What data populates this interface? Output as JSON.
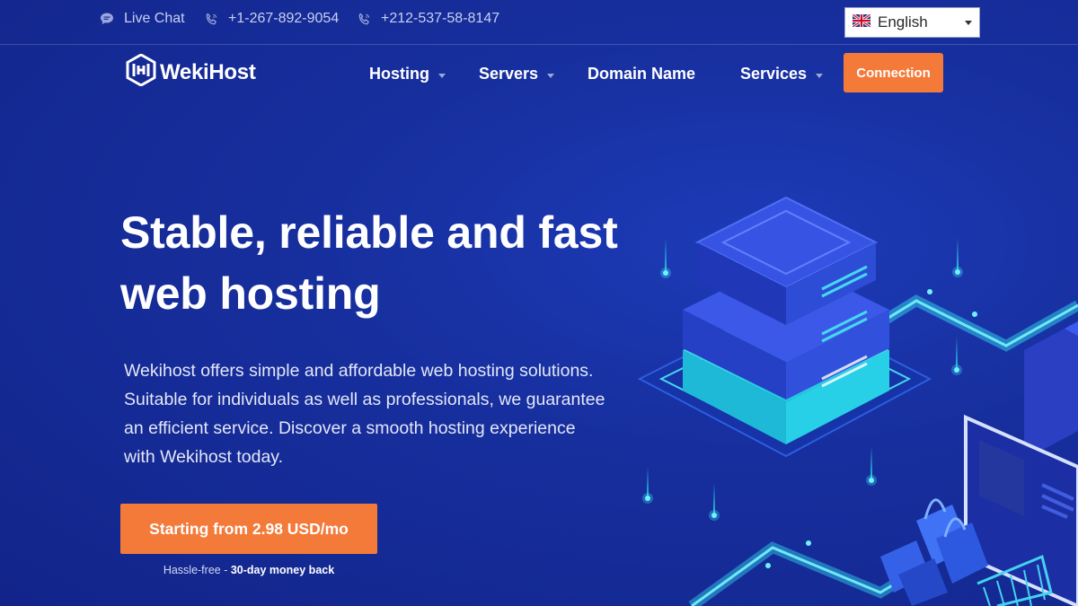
{
  "topbar": {
    "live_chat": "Live Chat",
    "phone_1": "+1-267-892-9054",
    "phone_2": "+212-537-58-8147",
    "language": "English"
  },
  "nav": {
    "logo_text": "WekiHost",
    "items": [
      {
        "label": "Hosting",
        "has_dropdown": true
      },
      {
        "label": "Servers",
        "has_dropdown": true
      },
      {
        "label": "Domain Name",
        "has_dropdown": false
      },
      {
        "label": "Services",
        "has_dropdown": true
      }
    ],
    "connection_label": "Connection"
  },
  "hero": {
    "title_line_1": "Stable, reliable and fast",
    "title_line_2": "web hosting",
    "description_lines": [
      "Wekihost offers simple and affordable web hosting solutions.",
      "Suitable for individuals as well as professionals, we guarantee",
      "an efficient service. Discover a smooth hosting experience",
      "with Wekihost today."
    ],
    "cta_label": "Starting from 2.98 USD/mo",
    "cta_note_prefix": "Hassle-free - ",
    "cta_note_bold": "30-day money back"
  },
  "colors": {
    "background": "#172f9e",
    "accent": "#f47a3a",
    "cyan": "#2de0ee"
  },
  "icons": {
    "chat": "chat-bubble-icon",
    "phone": "phone-icon",
    "flag": "uk-flag-icon",
    "logo": "wekihost-logo-icon"
  }
}
